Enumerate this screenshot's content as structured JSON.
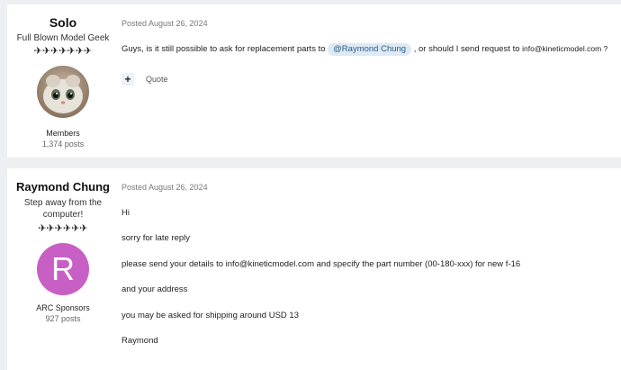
{
  "posts": [
    {
      "author": {
        "username": "Solo",
        "title": "Full Blown Model Geek",
        "rank_pips": "✈✈✈✈✈✈✈",
        "group": "Members",
        "post_count": "1,374 posts",
        "avatar": "cat-photo-avatar"
      },
      "posted": "Posted August 26, 2024",
      "content": {
        "part1": "Guys, is it still possible to ask for replacement parts to",
        "mention": "@Raymond Chung",
        "part2": ", or should I send request to",
        "email": "info@kineticmodel.com ?"
      },
      "actions": {
        "quote_label": "Quote",
        "multiquote_icon": "plus-icon"
      }
    },
    {
      "author": {
        "username": "Raymond Chung",
        "title": "Step away from the computer!",
        "rank_pips": "✈✈✈✈✈✈",
        "group": "ARC Sponsors",
        "post_count": "927 posts",
        "avatar_letter": "R",
        "avatar_color": "#c85fc5"
      },
      "posted": "Posted August 26, 2024",
      "paragraphs": [
        "Hi",
        "sorry for late reply",
        "please send your details to info@kineticmodel.com and specify the part number (00-180-xxx) for new f-16",
        "and your address",
        "you may be asked for shipping around USD 13",
        "Raymond"
      ]
    }
  ]
}
